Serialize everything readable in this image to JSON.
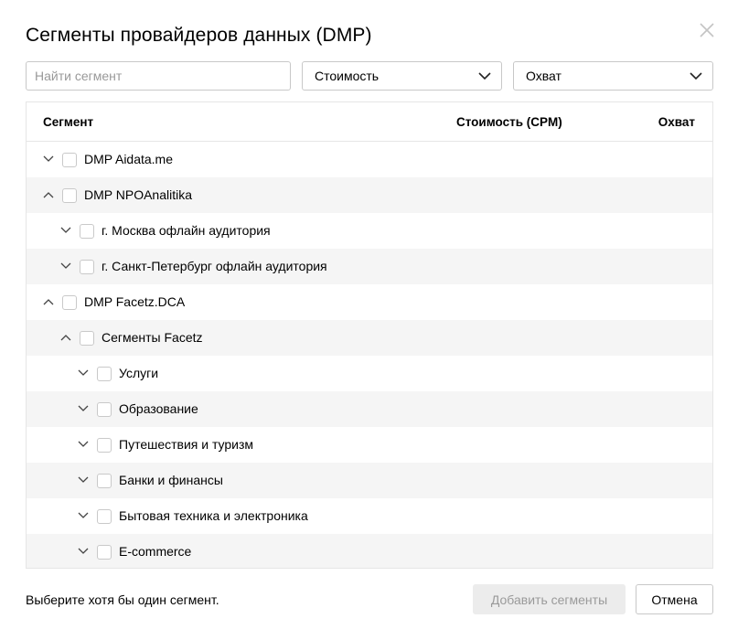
{
  "dialog": {
    "title": "Сегменты провайдеров данных (DMP)",
    "close_icon": "close-icon"
  },
  "filters": {
    "search_placeholder": "Найти сегмент",
    "search_value": "",
    "cost_select": "Стоимость",
    "reach_select": "Охват"
  },
  "table": {
    "columns": [
      "Сегмент",
      "Стоимость (CPM)",
      "Охват"
    ],
    "rows": [
      {
        "label": "DMP Aidata.me",
        "level": 0,
        "expanded": false,
        "checked": false
      },
      {
        "label": "DMP NPOAnalitika",
        "level": 0,
        "expanded": true,
        "checked": false
      },
      {
        "label": "г. Москва офлайн аудитория",
        "level": 1,
        "expanded": false,
        "checked": false
      },
      {
        "label": "г. Санкт-Петербург офлайн аудитория",
        "level": 1,
        "expanded": false,
        "checked": false
      },
      {
        "label": "DMP Facetz.DCA",
        "level": 0,
        "expanded": true,
        "checked": false
      },
      {
        "label": "Сегменты Facetz",
        "level": 1,
        "expanded": true,
        "checked": false
      },
      {
        "label": "Услуги",
        "level": 2,
        "expanded": false,
        "checked": false
      },
      {
        "label": "Образование",
        "level": 2,
        "expanded": false,
        "checked": false
      },
      {
        "label": "Путешествия и туризм",
        "level": 2,
        "expanded": false,
        "checked": false
      },
      {
        "label": "Банки и финансы",
        "level": 2,
        "expanded": false,
        "checked": false
      },
      {
        "label": "Бытовая техника и электроника",
        "level": 2,
        "expanded": false,
        "checked": false
      },
      {
        "label": "E-commerce",
        "level": 2,
        "expanded": false,
        "checked": false
      }
    ]
  },
  "footer": {
    "hint": "Выберите хотя бы один сегмент.",
    "add_label": "Добавить сегменты",
    "add_disabled": true,
    "cancel_label": "Отмена"
  },
  "colors": {
    "row_alt": "#f5f5f5",
    "border": "#e6e6e6",
    "disabled_text": "#9a9a9a"
  }
}
